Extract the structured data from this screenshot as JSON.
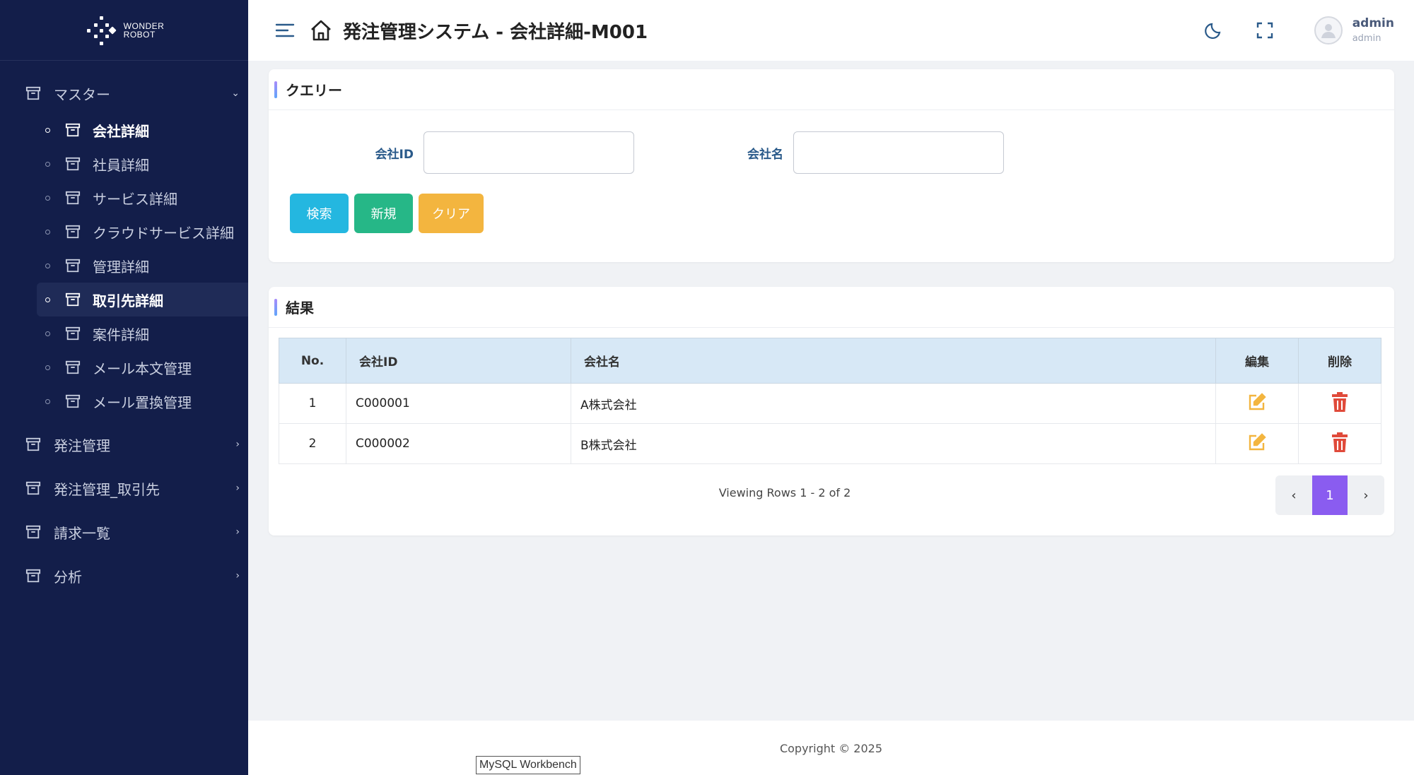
{
  "app": {
    "logo_text_1": "WONDER",
    "logo_text_2": "ROBOT",
    "title": "発注管理システム - 会社詳細-M001"
  },
  "sidebar": {
    "groups": [
      {
        "label": "マスター",
        "expanded": true
      },
      {
        "label": "発注管理"
      },
      {
        "label": "発注管理_取引先"
      },
      {
        "label": "請求一覧"
      },
      {
        "label": "分析"
      }
    ],
    "master_items": [
      {
        "label": "会社詳細"
      },
      {
        "label": "社員詳細"
      },
      {
        "label": "サービス詳細"
      },
      {
        "label": "クラウドサービス詳細"
      },
      {
        "label": "管理詳細"
      },
      {
        "label": "取引先詳細"
      },
      {
        "label": "案件詳細"
      },
      {
        "label": "メール本文管理"
      },
      {
        "label": "メール置換管理"
      }
    ]
  },
  "header": {
    "user_name": "admin",
    "user_role": "admin"
  },
  "query": {
    "title": "クエリー",
    "company_id_label": "会社ID",
    "company_id_value": "",
    "company_name_label": "会社名",
    "company_name_value": "",
    "search_label": "検索",
    "new_label": "新規",
    "clear_label": "クリア"
  },
  "results": {
    "title": "結果",
    "columns": [
      "No.",
      "会社ID",
      "会社名",
      "編集",
      "削除"
    ],
    "rows": [
      {
        "no": "1",
        "id": "C000001",
        "name": "A株式会社"
      },
      {
        "no": "2",
        "id": "C000002",
        "name": "B株式会社"
      }
    ],
    "viewing": "Viewing Rows 1 - 2 of 2",
    "current_page": "1"
  },
  "footer": {
    "copyright": "Copyright © 2025"
  },
  "taskbar_tooltip": "MySQL Workbench",
  "colors": {
    "sidebar_bg": "#131e4a",
    "search": "#24b7e0",
    "new": "#26b787",
    "clear": "#f3b53f",
    "edit_icon": "#f3b53f",
    "delete_icon": "#e04a3a",
    "page_active": "#8a5cf0"
  }
}
